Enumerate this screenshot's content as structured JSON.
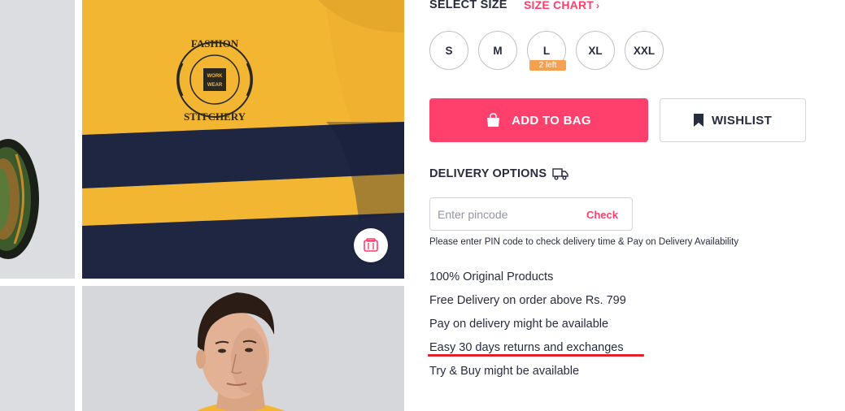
{
  "size_section": {
    "label": "SELECT SIZE",
    "chart_link": "SIZE CHART",
    "sizes": [
      {
        "label": "S"
      },
      {
        "label": "M"
      },
      {
        "label": "L",
        "badge": "2 left"
      },
      {
        "label": "XL"
      },
      {
        "label": "XXL"
      }
    ]
  },
  "actions": {
    "add_to_bag": "ADD TO BAG",
    "wishlist": "WISHLIST",
    "primary_color": "#ff3f6c"
  },
  "delivery": {
    "heading": "DELIVERY OPTIONS",
    "pincode_placeholder": "Enter pincode",
    "check_label": "Check",
    "help_text": "Please enter PIN code to check delivery time & Pay on Delivery Availability"
  },
  "features": [
    "100% Original Products",
    "Free Delivery on order above Rs. 799",
    "Pay on delivery might be available",
    "Easy 30 days returns and exchanges",
    "Try & Buy might be available"
  ],
  "product_image": {
    "print_text_top": "FASHION",
    "print_text_bottom": "STITCHERY",
    "print_text_center_1": "WORK",
    "print_text_center_2": "WEAR"
  },
  "icons": {
    "bag": "shopping-bag-icon",
    "wishlist": "bookmark-icon",
    "delivery": "truck-icon",
    "size_chart": "chevron-right-icon",
    "similar": "view-similar-icon"
  }
}
